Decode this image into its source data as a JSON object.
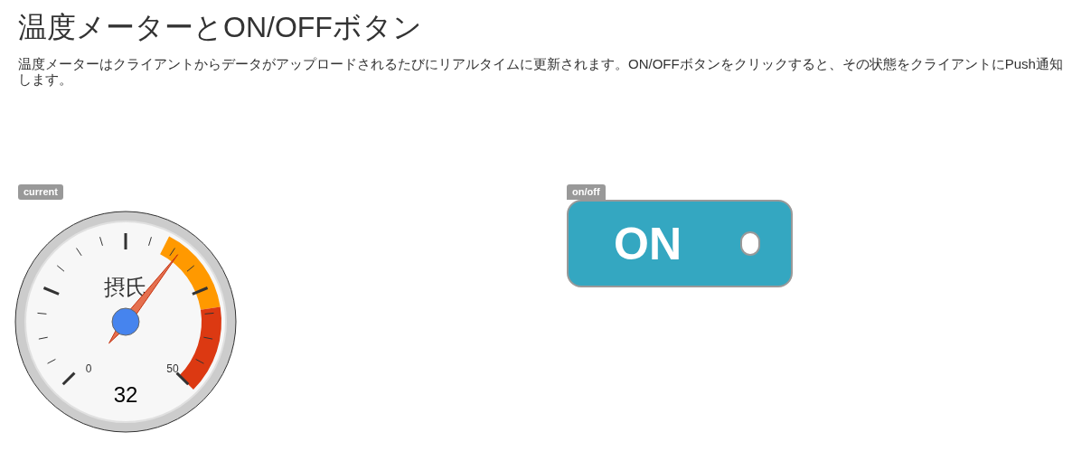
{
  "title": "温度メーターとON/OFFボタン",
  "description": "温度メーターはクライアントからデータがアップロードされるたびにリアルタイムに更新されます。ON/OFFボタンをクリックすると、その状態をクライアントにPush通知します。",
  "gauge": {
    "badge": "current",
    "unit": "摂氏",
    "min_label": "0",
    "max_label": "50",
    "reading": "32"
  },
  "switch": {
    "badge": "on/off",
    "label": "ON",
    "on": true
  }
}
